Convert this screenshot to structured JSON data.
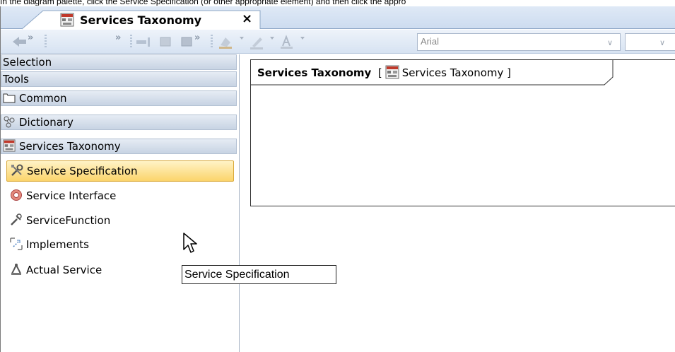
{
  "instruction": "In the diagram palette, click the Service Specification (or other appropriate element) and then click the appro",
  "tab": {
    "label": "Services Taxonomy",
    "close": "×"
  },
  "toolbar": {
    "font_value": "Arial",
    "chevron": "»"
  },
  "palette": {
    "headers": [
      {
        "label": "Selection"
      },
      {
        "label": "Tools"
      },
      {
        "label": "Common",
        "icon": "folder-icon"
      },
      {
        "label": "Dictionary",
        "icon": "dictionary-icon"
      },
      {
        "label": "Services Taxonomy",
        "icon": "taxonomy-diagram-icon"
      }
    ],
    "items": [
      {
        "label": "Service Specification",
        "icon": "wrench-screwdriver-icon",
        "selected": true
      },
      {
        "label": "Service Interface",
        "icon": "service-interface-icon"
      },
      {
        "label": "ServiceFunction",
        "icon": "service-function-icon"
      },
      {
        "label": "Implements",
        "icon": "implements-icon"
      },
      {
        "label": "Actual Service",
        "icon": "actual-service-icon"
      }
    ]
  },
  "diagram": {
    "frame_title": "Services Taxonomy",
    "frame_open_bracket": "[",
    "frame_ref": "Services Taxonomy",
    "frame_close_bracket": "]"
  },
  "tooltip": {
    "text": "Service Specification"
  },
  "colors": {
    "tab_strip": "#cddcf0",
    "selected_item": "#fbd46b",
    "palette_header": "#c7d3e3"
  }
}
